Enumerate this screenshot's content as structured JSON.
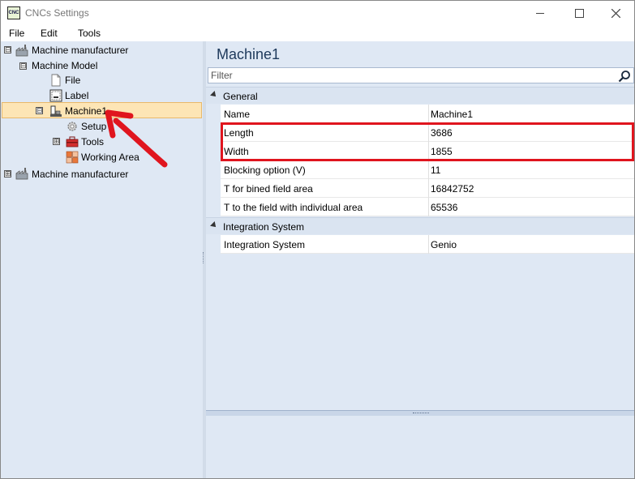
{
  "window": {
    "title": "CNCs Settings",
    "icon_text": "CNC"
  },
  "menu": {
    "items": [
      "File",
      "Edit",
      "Tools"
    ]
  },
  "tree": {
    "nodes": [
      {
        "label": "Machine manufacturer",
        "expander": "⊟",
        "icon": "factory-icon"
      },
      {
        "label": "Machine Model",
        "expander": "⊟",
        "icon": "none"
      },
      {
        "label": "File",
        "icon": "file-icon"
      },
      {
        "label": "Label",
        "icon": "label-icon"
      },
      {
        "label": "Machine1",
        "expander": "⊟",
        "icon": "machine-icon",
        "selected": true
      },
      {
        "label": "Setup",
        "icon": "gear-icon"
      },
      {
        "label": "Tools",
        "expander": "⊞",
        "icon": "toolbox-icon"
      },
      {
        "label": "Working Area",
        "icon": "working-area-icon"
      },
      {
        "label": "Machine manufacturer",
        "expander": "⊞",
        "icon": "factory-icon"
      }
    ]
  },
  "details": {
    "title": "Machine1",
    "filter_placeholder": "Filter",
    "categories": [
      {
        "label": "General",
        "properties": [
          {
            "name": "Name",
            "value": "Machine1"
          },
          {
            "name": "Length",
            "value": "3686"
          },
          {
            "name": "Width",
            "value": "1855"
          },
          {
            "name": "Blocking option (V)",
            "value": "11"
          },
          {
            "name": "T for bined field area",
            "value": "16842752"
          },
          {
            "name": "T to the field with individual area",
            "value": "65536"
          }
        ]
      },
      {
        "label": "Integration System",
        "properties": [
          {
            "name": "Integration System",
            "value": "Genio"
          }
        ]
      }
    ]
  },
  "colors": {
    "accent_highlight": "#e0151e",
    "selection": "#fde5b5",
    "panel_bg": "#dfe8f4"
  }
}
